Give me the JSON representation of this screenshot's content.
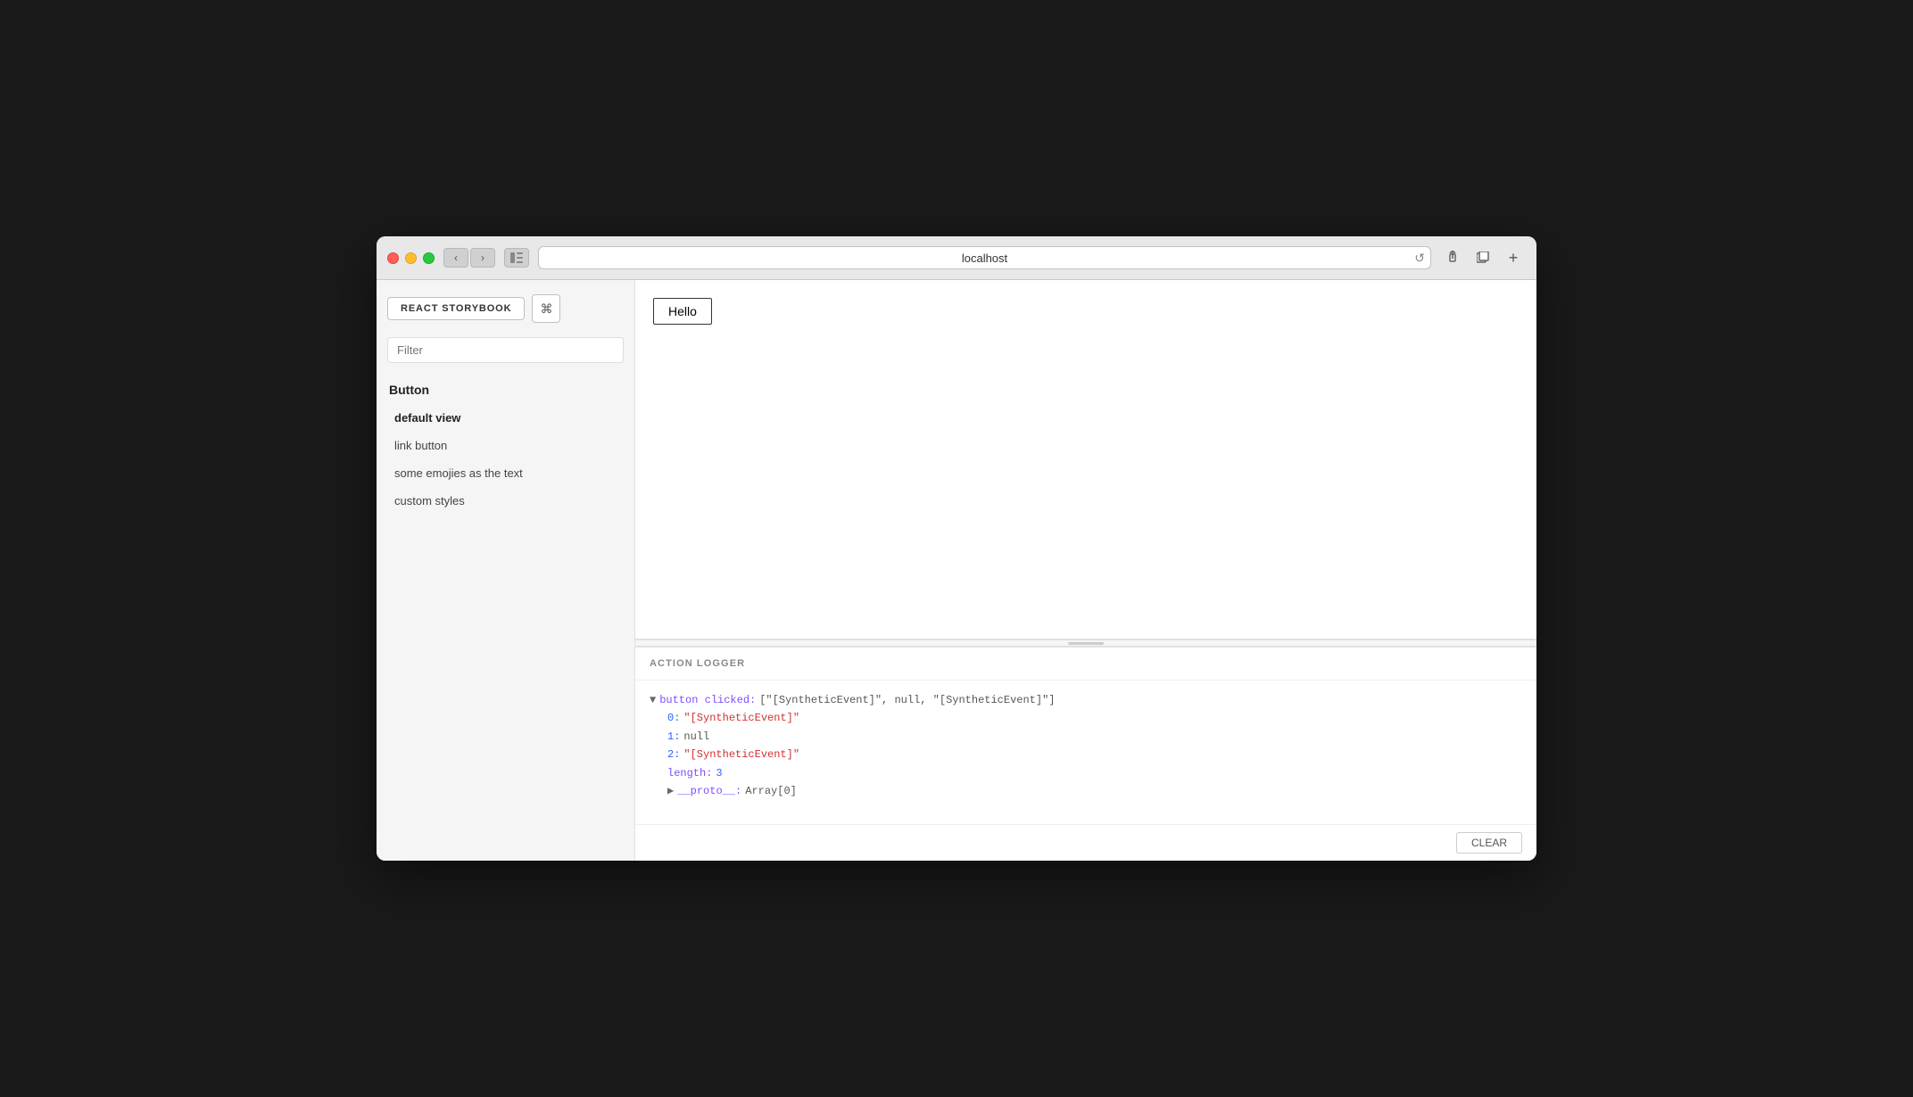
{
  "browser": {
    "url": "localhost",
    "add_tab_label": "+"
  },
  "sidebar": {
    "title_button": "REACT STORYBOOK",
    "cmd_icon": "⌘",
    "filter_placeholder": "Filter",
    "section_title": "Button",
    "nav_items": [
      {
        "label": "default view",
        "active": true
      },
      {
        "label": "link button",
        "active": false
      },
      {
        "label": "some emojies as the text",
        "active": false
      },
      {
        "label": "custom styles",
        "active": false
      }
    ]
  },
  "preview": {
    "hello_button_label": "Hello"
  },
  "action_logger": {
    "header": "ACTION LOGGER",
    "log": {
      "event_name": "button clicked:",
      "array_preview": "[\"[SyntheticEvent]\", null, \"[SyntheticEvent]\"]",
      "item_0_key": "0:",
      "item_0_val": "\"[SyntheticEvent]\"",
      "item_1_key": "1:",
      "item_1_val": "null",
      "item_2_key": "2:",
      "item_2_val": "\"[SyntheticEvent]\"",
      "length_key": "length:",
      "length_val": "3",
      "proto_key": "__proto__:",
      "proto_val": "Array[0]"
    },
    "clear_button": "CLEAR"
  },
  "icons": {
    "back": "‹",
    "forward": "›",
    "refresh": "↺",
    "share": "↑",
    "duplicate": "⧉"
  }
}
